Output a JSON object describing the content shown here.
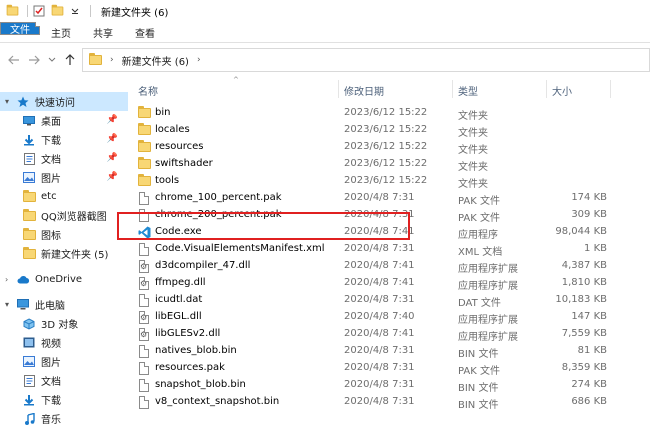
{
  "window": {
    "title": "新建文件夹 (6)"
  },
  "ribbon": {
    "tabs": [
      {
        "label": "文件"
      },
      {
        "label": "主页"
      },
      {
        "label": "共享"
      },
      {
        "label": "查看"
      }
    ]
  },
  "address": {
    "path": "新建文件夹 (6)"
  },
  "sidebar": {
    "items": [
      {
        "label": "快速访问",
        "icon": "star-icon"
      },
      {
        "label": "桌面",
        "icon": "desktop-icon"
      },
      {
        "label": "下载",
        "icon": "download-icon"
      },
      {
        "label": "文档",
        "icon": "document-icon"
      },
      {
        "label": "图片",
        "icon": "picture-icon"
      },
      {
        "label": "etc",
        "icon": "folder-icon"
      },
      {
        "label": "QQ浏览器截图",
        "icon": "folder-icon"
      },
      {
        "label": "图标",
        "icon": "folder-icon"
      },
      {
        "label": "新建文件夹 (5)",
        "icon": "folder-icon"
      },
      {
        "label": "OneDrive",
        "icon": "cloud-icon"
      },
      {
        "label": "此电脑",
        "icon": "computer-icon"
      },
      {
        "label": "3D 对象",
        "icon": "cube-icon"
      },
      {
        "label": "视频",
        "icon": "video-icon"
      },
      {
        "label": "图片",
        "icon": "picture-icon"
      },
      {
        "label": "文档",
        "icon": "document-icon"
      },
      {
        "label": "下载",
        "icon": "download-icon"
      },
      {
        "label": "音乐",
        "icon": "music-icon"
      }
    ]
  },
  "columns": {
    "name": "名称",
    "date": "修改日期",
    "type": "类型",
    "size": "大小"
  },
  "files": [
    {
      "name": "bin",
      "date": "2023/6/12 15:22",
      "type": "文件夹",
      "size": "",
      "icon": "folder"
    },
    {
      "name": "locales",
      "date": "2023/6/12 15:22",
      "type": "文件夹",
      "size": "",
      "icon": "folder"
    },
    {
      "name": "resources",
      "date": "2023/6/12 15:22",
      "type": "文件夹",
      "size": "",
      "icon": "folder"
    },
    {
      "name": "swiftshader",
      "date": "2023/6/12 15:22",
      "type": "文件夹",
      "size": "",
      "icon": "folder"
    },
    {
      "name": "tools",
      "date": "2023/6/12 15:22",
      "type": "文件夹",
      "size": "",
      "icon": "folder"
    },
    {
      "name": "chrome_100_percent.pak",
      "date": "2020/4/8 7:31",
      "type": "PAK 文件",
      "size": "174 KB",
      "icon": "file"
    },
    {
      "name": "chrome_200_percent.pak",
      "date": "2020/4/8 7:31",
      "type": "PAK 文件",
      "size": "309 KB",
      "icon": "file"
    },
    {
      "name": "Code.exe",
      "date": "2020/4/8 7:41",
      "type": "应用程序",
      "size": "98,044 KB",
      "icon": "vscode"
    },
    {
      "name": "Code.VisualElementsManifest.xml",
      "date": "2020/4/8 7:31",
      "type": "XML 文档",
      "size": "1 KB",
      "icon": "file"
    },
    {
      "name": "d3dcompiler_47.dll",
      "date": "2020/4/8 7:41",
      "type": "应用程序扩展",
      "size": "4,387 KB",
      "icon": "gear"
    },
    {
      "name": "ffmpeg.dll",
      "date": "2020/4/8 7:41",
      "type": "应用程序扩展",
      "size": "1,810 KB",
      "icon": "gear"
    },
    {
      "name": "icudtl.dat",
      "date": "2020/4/8 7:31",
      "type": "DAT 文件",
      "size": "10,183 KB",
      "icon": "file"
    },
    {
      "name": "libEGL.dll",
      "date": "2020/4/8 7:40",
      "type": "应用程序扩展",
      "size": "147 KB",
      "icon": "gear"
    },
    {
      "name": "libGLESv2.dll",
      "date": "2020/4/8 7:41",
      "type": "应用程序扩展",
      "size": "7,559 KB",
      "icon": "gear"
    },
    {
      "name": "natives_blob.bin",
      "date": "2020/4/8 7:31",
      "type": "BIN 文件",
      "size": "81 KB",
      "icon": "file"
    },
    {
      "name": "resources.pak",
      "date": "2020/4/8 7:31",
      "type": "PAK 文件",
      "size": "8,359 KB",
      "icon": "file"
    },
    {
      "name": "snapshot_blob.bin",
      "date": "2020/4/8 7:31",
      "type": "BIN 文件",
      "size": "274 KB",
      "icon": "file"
    },
    {
      "name": "v8_context_snapshot.bin",
      "date": "2020/4/8 7:31",
      "type": "BIN 文件",
      "size": "686 KB",
      "icon": "file"
    }
  ],
  "colors": {
    "accent": "#1979ca",
    "selected": "#cce8ff",
    "highlight": "#e02020",
    "folder": "#f8d775"
  }
}
